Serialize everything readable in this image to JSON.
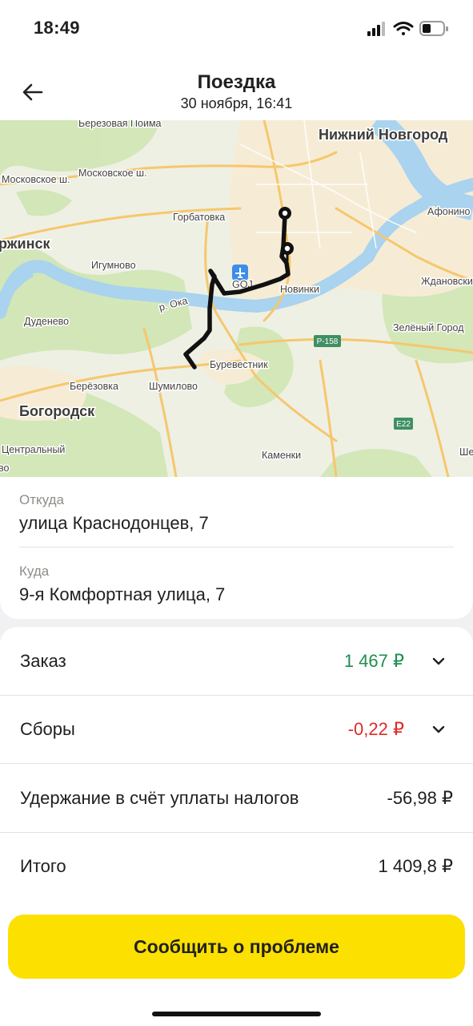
{
  "status_bar": {
    "time": "18:49"
  },
  "header": {
    "title": "Поездка",
    "subtitle": "30 ноября, 16:41"
  },
  "map": {
    "labels": {
      "berezovaya_poima": "Березовая Пойма",
      "nizhny_novgorod": "Нижний Новгород",
      "moskovskoe_sh": "Московское ш.",
      "moskovskoe_sh2": "Московское ш.",
      "gorbatovka": "Горбатовка",
      "afonino": "Афонино",
      "dzerzhinsk": "ржинск",
      "igumnovo": "Игумново",
      "goj": "GOJ",
      "novinki": "Новинки",
      "zhdanovsky": "Ждановски",
      "oka": "р. Ока",
      "dudenevo": "Дуденево",
      "zeleny_gorod": "Зелёный Город",
      "r158": "Р-158",
      "burevestnik": "Буревестник",
      "berezovka": "Берёзовка",
      "shumilovo": "Шумилово",
      "bogorodsk": "Богородск",
      "e22": "E22",
      "centralny": "Центральный",
      "kamenki": "Каменки",
      "she": "Ше",
      "vo": "во"
    }
  },
  "route": {
    "from_label": "Откуда",
    "from_value": "улица Краснодонцев, 7",
    "to_label": "Куда",
    "to_value": "9-я Комфортная улица, 7"
  },
  "breakdown": {
    "order_label": "Заказ",
    "order_value": "1 467 ₽",
    "fees_label": "Сборы",
    "fees_value": "-0,22 ₽",
    "tax_label": "Удержание в счёт уплаты налогов",
    "tax_value": "-56,98 ₽",
    "total_label": "Итого",
    "total_value": "1 409,8 ₽"
  },
  "actions": {
    "report_problem": "Сообщить о проблеме"
  },
  "colors": {
    "accent": "#fce000",
    "positive": "#1f8e4f",
    "negative": "#dd2a2a"
  }
}
